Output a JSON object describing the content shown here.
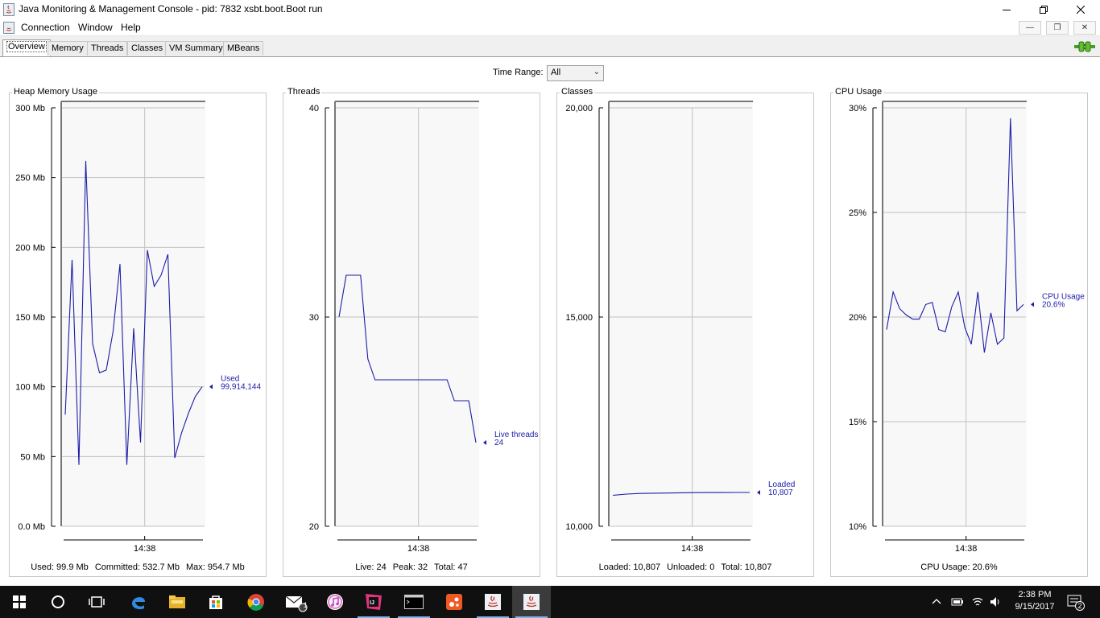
{
  "window": {
    "title": "Java Monitoring & Management Console - pid: 7832 xsbt.boot.Boot run",
    "minimize_icon": "minimize-icon",
    "maximize_icon": "restore-icon",
    "close_icon": "close-icon"
  },
  "menubar": {
    "items": [
      "Connection",
      "Window",
      "Help"
    ],
    "mdi_buttons": [
      "minimize",
      "restore",
      "close"
    ]
  },
  "tabs": [
    {
      "label": "Overview",
      "active": true
    },
    {
      "label": "Memory",
      "active": false
    },
    {
      "label": "Threads",
      "active": false
    },
    {
      "label": "Classes",
      "active": false
    },
    {
      "label": "VM Summary",
      "active": false
    },
    {
      "label": "MBeans",
      "active": false
    }
  ],
  "connection_icon": "connected-plug-icon",
  "time_range": {
    "label": "Time Range:",
    "value": "All"
  },
  "colors": {
    "series": "#1c1ca8",
    "grid": "#c0c0c0",
    "plot_bg": "#f8f8f8"
  },
  "panels": [
    {
      "title": "Heap Memory Usage",
      "summary": [
        "Used: 99.9 Mb",
        "Committed: 532.7 Mb",
        "Max: 954.7 Mb"
      ]
    },
    {
      "title": "Threads",
      "summary": [
        "Live: 24",
        "Peak: 32",
        "Total: 47"
      ]
    },
    {
      "title": "Classes",
      "summary": [
        "Loaded: 10,807",
        "Unloaded: 0",
        "Total: 10,807"
      ]
    },
    {
      "title": "CPU Usage",
      "summary": [
        "CPU Usage: 20.6%"
      ]
    }
  ],
  "chart_data": [
    {
      "type": "line",
      "title": "Heap Memory Usage",
      "ylim": [
        0,
        300
      ],
      "y_ticks": [
        "300 Mb",
        "250 Mb",
        "200 Mb",
        "150 Mb",
        "100 Mb",
        "50 Mb",
        "0.0 Mb"
      ],
      "y_tick_values": [
        300,
        250,
        200,
        150,
        100,
        50,
        0
      ],
      "x_tick": "14:38",
      "x_tick_fraction": 0.58,
      "legend_name": "Used",
      "legend_value": "99,914,144",
      "series": [
        {
          "name": "Used",
          "values": [
            80,
            191,
            44,
            262,
            131,
            110,
            112,
            140,
            188,
            44,
            142,
            60,
            198,
            172,
            180,
            195,
            49,
            67,
            81,
            93,
            100
          ]
        }
      ]
    },
    {
      "type": "line",
      "title": "Threads",
      "ylim": [
        20,
        40
      ],
      "y_ticks": [
        "40",
        "30",
        "20"
      ],
      "y_tick_values": [
        40,
        30,
        20
      ],
      "x_tick": "14:38",
      "x_tick_fraction": 0.58,
      "legend_name": "Live threads",
      "legend_value": "24",
      "series": [
        {
          "name": "Live threads",
          "values": [
            30,
            32,
            32,
            32,
            28,
            27,
            27,
            27,
            27,
            27,
            27,
            27,
            27,
            27,
            27,
            27,
            26,
            26,
            26,
            24
          ]
        }
      ]
    },
    {
      "type": "line",
      "title": "Classes",
      "ylim": [
        10000,
        20000
      ],
      "y_ticks": [
        "20,000",
        "15,000",
        "10,000"
      ],
      "y_tick_values": [
        20000,
        15000,
        10000
      ],
      "x_tick": "14:38",
      "x_tick_fraction": 0.58,
      "legend_name": "Loaded",
      "legend_value": "10,807",
      "series": [
        {
          "name": "Loaded",
          "values": [
            10740,
            10770,
            10785,
            10790,
            10795,
            10800,
            10803,
            10805,
            10806,
            10807,
            10807
          ]
        }
      ]
    },
    {
      "type": "line",
      "title": "CPU Usage",
      "ylim": [
        10,
        30
      ],
      "y_ticks": [
        "30%",
        "25%",
        "20%",
        "15%",
        "10%"
      ],
      "y_tick_values": [
        30,
        25,
        20,
        15,
        10
      ],
      "x_tick": "14:38",
      "x_tick_fraction": 0.58,
      "legend_name": "CPU Usage",
      "legend_value": "20.6%",
      "series": [
        {
          "name": "CPU Usage",
          "values": [
            19.4,
            21.2,
            20.4,
            20.1,
            19.9,
            19.9,
            20.6,
            20.7,
            19.4,
            19.3,
            20.5,
            21.2,
            19.5,
            18.7,
            21.2,
            18.3,
            20.2,
            18.7,
            19.0,
            29.5,
            20.3,
            20.6
          ]
        }
      ]
    }
  ],
  "taskbar": {
    "items": [
      {
        "name": "start-icon"
      },
      {
        "name": "cortana-icon"
      },
      {
        "name": "task-view-icon"
      },
      {
        "name": "edge-icon"
      },
      {
        "name": "file-explorer-icon"
      },
      {
        "name": "store-icon"
      },
      {
        "name": "chrome-icon"
      },
      {
        "name": "mail-icon",
        "badge": "1"
      },
      {
        "name": "itunes-icon"
      },
      {
        "name": "intellij-icon"
      },
      {
        "name": "terminal-icon"
      },
      {
        "name": "app-icon"
      },
      {
        "name": "java-icon"
      },
      {
        "name": "java-console-icon"
      }
    ],
    "time": "2:38 PM",
    "date": "9/15/2017",
    "notification_count": "2"
  }
}
